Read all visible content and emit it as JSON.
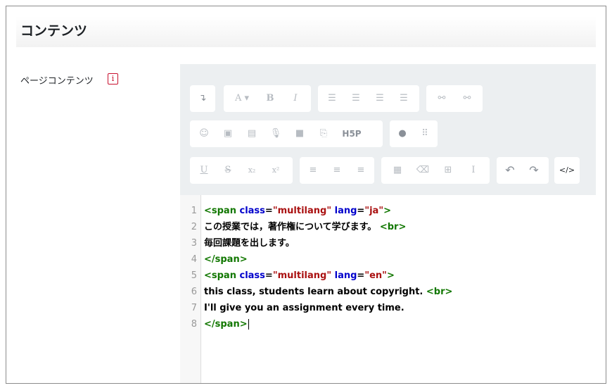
{
  "section": {
    "title": "コンテンツ"
  },
  "field": {
    "label": "ページコンテンツ",
    "help_icon": "i"
  },
  "toolbar": {
    "row1": {
      "para": "↴",
      "font_color": "A ▾",
      "bold": "B",
      "italic": "I",
      "ul": "☰",
      "ol": "☰",
      "outdent": "☰",
      "indent": "☰",
      "link": "⚯",
      "unlink": "⚯"
    },
    "row2": {
      "emoji": "☺",
      "image": "▣",
      "media": "▤",
      "record_audio": "🎙",
      "record_video": "■",
      "manage_files": "⎘",
      "h5p": "H5P",
      "accessibility": "●",
      "braille": "⠿"
    },
    "row3": {
      "underline": "U",
      "strike": "S",
      "subscript": "x₂",
      "superscript": "x²",
      "align_left": "≡",
      "align_center": "≡",
      "align_right": "≡",
      "equation": "▦",
      "clear": "⌫",
      "table": "⊞",
      "cursor_text": "I",
      "undo": "↶",
      "redo": "↷",
      "html": "</>"
    }
  },
  "code": {
    "lines": [
      {
        "n": "1",
        "t1": "<span ",
        "a1": "class",
        "eq1": "=",
        "s1": "\"multilang\"",
        "a2": " lang",
        "eq2": "=",
        "s2": "\"ja\"",
        "t2": ">"
      },
      {
        "n": "2",
        "text": "この授業では，著作権について学びます。",
        "tag": "<br>"
      },
      {
        "n": "3",
        "text": "毎回課題を出します。"
      },
      {
        "n": "4",
        "tag": "</span>"
      },
      {
        "n": "5",
        "t1": "<span ",
        "a1": "class",
        "eq1": "=",
        "s1": "\"multilang\"",
        "a2": " lang",
        "eq2": "=",
        "s2": "\"en\"",
        "t2": ">"
      },
      {
        "n": "6",
        "text": "this class, students learn about copyright. ",
        "tag": "<br>"
      },
      {
        "n": "7",
        "text": "I'll give you an assignment every time."
      },
      {
        "n": "8",
        "tag": "</span>"
      }
    ]
  }
}
